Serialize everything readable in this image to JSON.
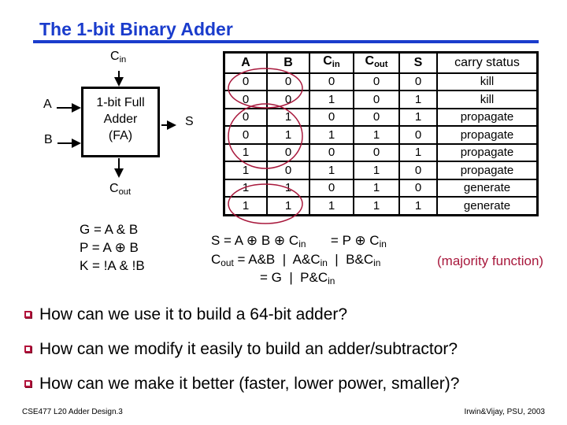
{
  "title": "The 1-bit Binary Adder",
  "diagram": {
    "cin_label": "C",
    "cin_sub": "in",
    "a_label": "A",
    "b_label": "B",
    "s_label": "S",
    "cout_label": "C",
    "cout_sub": "out",
    "box_lines": [
      "1-bit Full",
      "Adder",
      "(FA)"
    ]
  },
  "definitions": [
    "G = A & B",
    "P = A ⊕ B",
    "K = !A & !B"
  ],
  "truth_table": {
    "headers": [
      {
        "main": "A",
        "sub": ""
      },
      {
        "main": "B",
        "sub": ""
      },
      {
        "main": "C",
        "sub": "in"
      },
      {
        "main": "C",
        "sub": "out"
      },
      {
        "main": "S",
        "sub": ""
      },
      {
        "main": "carry status",
        "sub": ""
      }
    ],
    "rows": [
      [
        "0",
        "0",
        "0",
        "0",
        "0",
        "kill"
      ],
      [
        "0",
        "0",
        "1",
        "0",
        "1",
        "kill"
      ],
      [
        "0",
        "1",
        "0",
        "0",
        "1",
        "propagate"
      ],
      [
        "0",
        "1",
        "1",
        "1",
        "0",
        "propagate"
      ],
      [
        "1",
        "0",
        "0",
        "0",
        "1",
        "propagate"
      ],
      [
        "1",
        "0",
        "1",
        "1",
        "0",
        "propagate"
      ],
      [
        "1",
        "1",
        "0",
        "1",
        "0",
        "generate"
      ],
      [
        "1",
        "1",
        "1",
        "1",
        "1",
        "generate"
      ]
    ],
    "highlight_color": "#a8183c"
  },
  "equations": {
    "line1_a": "S = A ⊕ B ⊕ C",
    "line1_a_sub": "in",
    "line1_b": "= P ⊕ C",
    "line1_b_sub": "in",
    "line2_a": "C",
    "line2_a_sub": "out",
    "line2_b": " = A&B  |  A&C",
    "line2_b_sub": "in",
    "line2_c": "  |  B&C",
    "line2_c_sub": "in",
    "line2_note": "(majority function)",
    "line3_a": "= G  |  P&C",
    "line3_a_sub": "in"
  },
  "bullets": [
    "How can we use it to build a 64-bit adder?",
    "How can we modify it easily to build an adder/subtractor?",
    "How can we make it better (faster, lower power, smaller)?"
  ],
  "footer": {
    "left": "CSE477  L20 Adder Design.3",
    "right": "Irwin&Vijay, PSU, 2003"
  },
  "colors": {
    "title": "#1a3ccc",
    "accent_red": "#a8183c"
  }
}
